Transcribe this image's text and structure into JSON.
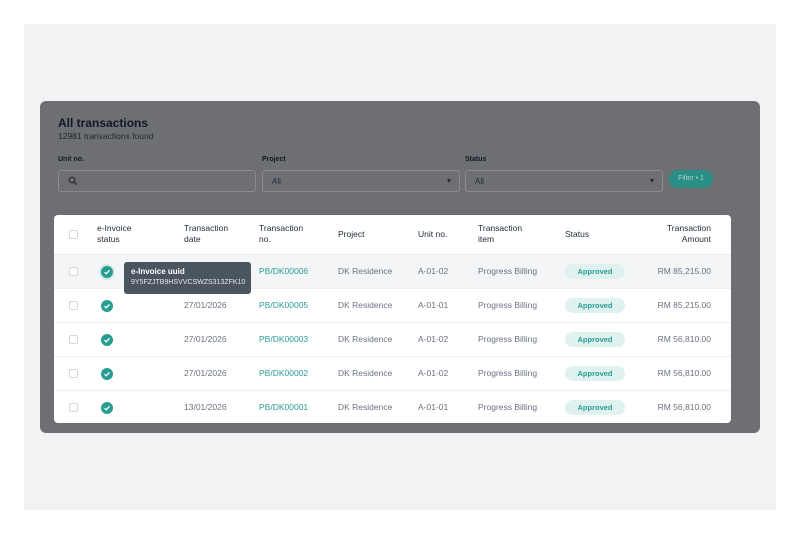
{
  "page": {
    "title": "All transactions",
    "subtitle": "12981 transactions found"
  },
  "filters": {
    "unit_label": "Unit no.",
    "unit_value": "",
    "project_label": "Project",
    "project_value": "All",
    "status_label": "Status",
    "status_value": "All",
    "filter_button": "Filter • 1"
  },
  "table": {
    "headers": {
      "einvoice_1": "e-Invoice",
      "einvoice_2": "status",
      "date_1": "Transaction",
      "date_2": "date",
      "no_1": "Transaction",
      "no_2": "no.",
      "project": "Project",
      "unit": "Unit no.",
      "item_1": "Transaction",
      "item_2": "item",
      "status": "Status",
      "amount_1": "Transaction",
      "amount_2": "Amount"
    },
    "rows": [
      {
        "date": "",
        "no": "PB/DK00006",
        "project": "DK Residence",
        "unit": "A-01-02",
        "item": "Progress Billing",
        "status": "Approved",
        "amount": "RM 85,215.00"
      },
      {
        "date": "27/01/2026",
        "no": "PB/DK00005",
        "project": "DK Residence",
        "unit": "A-01-01",
        "item": "Progress Billing",
        "status": "Approved",
        "amount": "RM 85,215.00"
      },
      {
        "date": "27/01/2026",
        "no": "PB/DK00003",
        "project": "DK Residence",
        "unit": "A-01-02",
        "item": "Progress Billing",
        "status": "Approved",
        "amount": "RM 56,810.00"
      },
      {
        "date": "27/01/2026",
        "no": "PB/DK00002",
        "project": "DK Residence",
        "unit": "A-01-02",
        "item": "Progress Billing",
        "status": "Approved",
        "amount": "RM 56,810.00"
      },
      {
        "date": "13/01/2026",
        "no": "PB/DK00001",
        "project": "DK Residence",
        "unit": "A-01-01",
        "item": "Progress Billing",
        "status": "Approved",
        "amount": "RM 56,810.00"
      }
    ]
  },
  "tooltip": {
    "title": "e-Invoice uuid",
    "value": "9Y5FZJTB9HSVVCSWZS313ZFK10"
  },
  "colors": {
    "accent": "#2a9d93",
    "overlay": "#6e6f72",
    "badge_bg": "#dff2ef"
  },
  "icons": {
    "search": "search-icon",
    "caret": "chevron-down-icon",
    "einvoice": "check-circle-icon"
  }
}
